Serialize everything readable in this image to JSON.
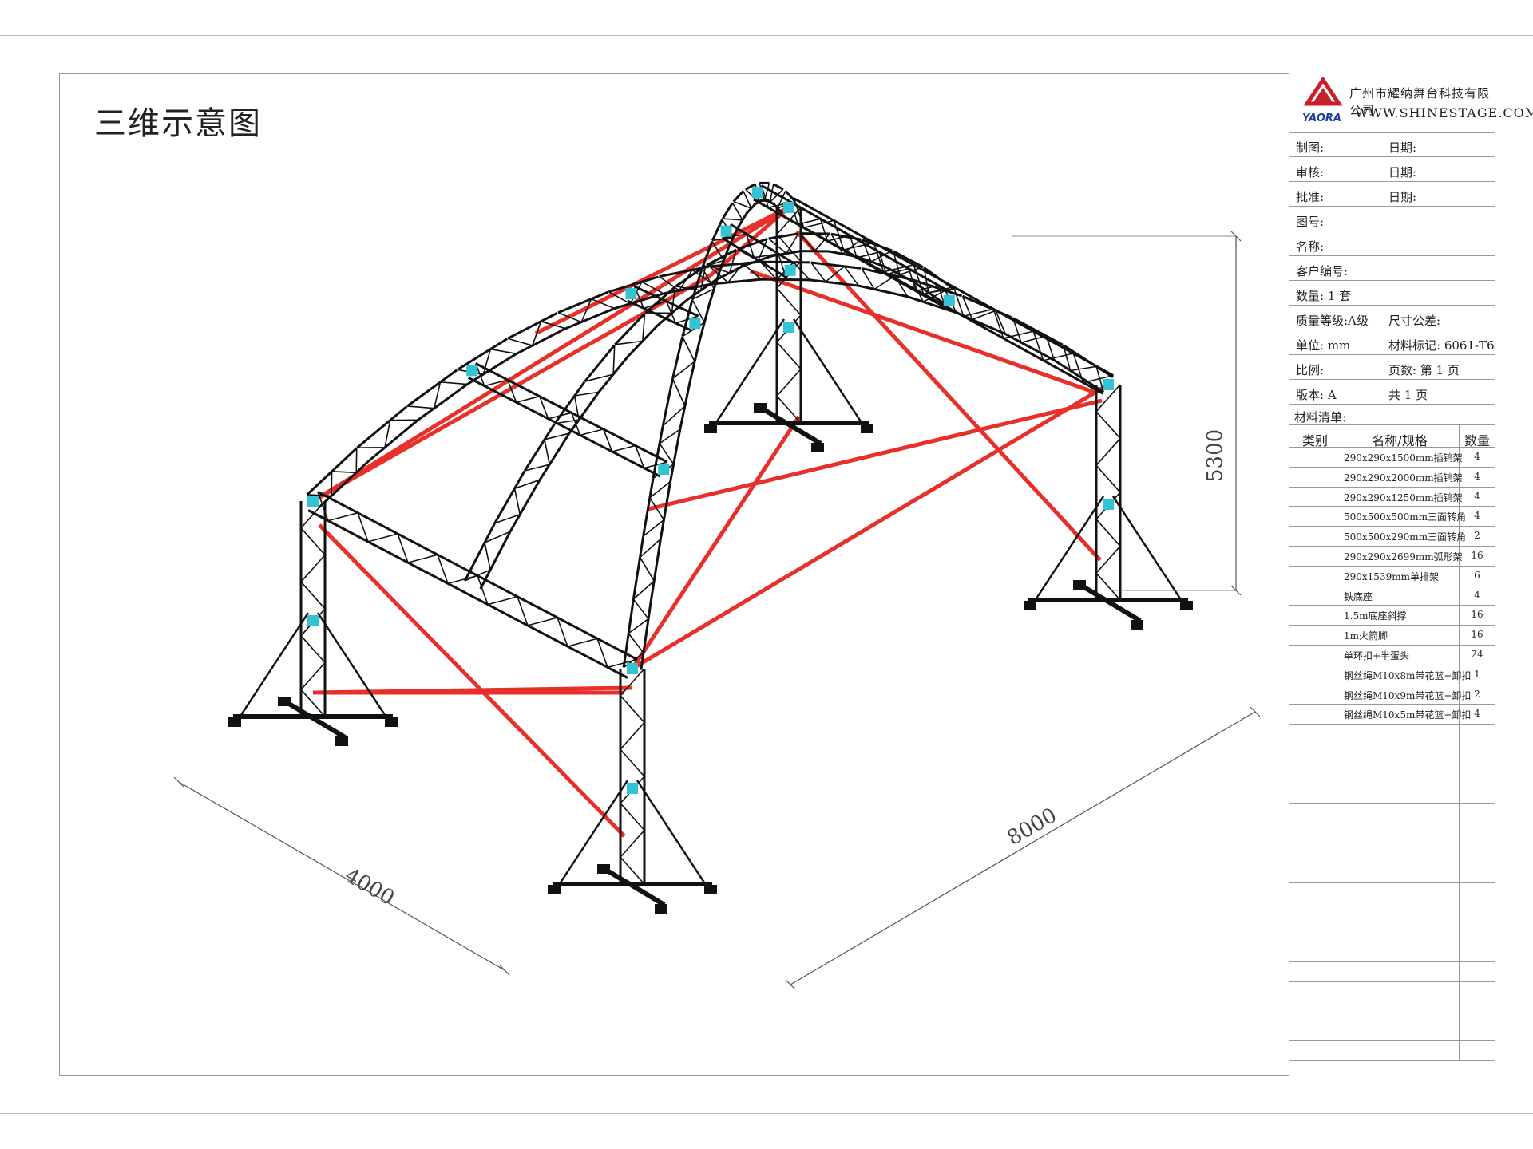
{
  "drawing_title": "三维示意图",
  "company": {
    "name_cn": "广州市耀纳舞台科技有限公司",
    "website": "WWW.SHINESTAGE.COM",
    "logo_text": "YAORA"
  },
  "title_block": {
    "rows": [
      {
        "label": "制图:",
        "right_label": "日期:"
      },
      {
        "label": "审核:",
        "right_label": "日期:"
      },
      {
        "label": "批准:",
        "right_label": "日期:"
      },
      {
        "label": "图号:",
        "right_label": ""
      },
      {
        "label": "名称:",
        "right_label": ""
      },
      {
        "label": "客户编号:",
        "right_label": ""
      },
      {
        "label": "数量:  1  套",
        "right_label": ""
      },
      {
        "label": "质量等级:A级",
        "right_label": "尺寸公差:"
      },
      {
        "label": "单位:    mm",
        "right_label": "材料标记: 6061-T6"
      },
      {
        "label": "比例:",
        "right_label": "页数: 第     1 页"
      },
      {
        "label": "版本:   A",
        "right_label": "共     1 页"
      }
    ],
    "bom_title": "材料清单:"
  },
  "bom": {
    "headers": [
      "类别",
      "名称/规格",
      "数量"
    ],
    "rows": [
      {
        "name": "290x290x1500mm插销架",
        "qty": "4"
      },
      {
        "name": "290x290x2000mm插销架",
        "qty": "4"
      },
      {
        "name": "290x290x1250mm插销架",
        "qty": "4"
      },
      {
        "name": "500x500x500mm三面转角",
        "qty": "4"
      },
      {
        "name": "500x500x290mm三面转角",
        "qty": "2"
      },
      {
        "name": "290x290x2699mm弧形架",
        "qty": "16"
      },
      {
        "name": "290x1539mm单排架",
        "qty": "6"
      },
      {
        "name": "铁底座",
        "qty": "4"
      },
      {
        "name": "1.5m底座斜撑",
        "qty": "16"
      },
      {
        "name": "1m火箭脚",
        "qty": "16"
      },
      {
        "name": "单环扣+半蛋头",
        "qty": "24"
      },
      {
        "name": "钢丝绳M10x8m带花篮+卸扣",
        "qty": "1"
      },
      {
        "name": "钢丝绳M10x9m带花篮+卸扣",
        "qty": "2"
      },
      {
        "name": "钢丝绳M10x5m带花篮+卸扣",
        "qty": "4"
      }
    ],
    "empty_rows": 17
  },
  "dimensions": {
    "width": "4000",
    "length": "8000",
    "height": "5300"
  },
  "colors": {
    "truss": "#111111",
    "cable": "#e8302a",
    "clamp": "#33c4d4",
    "frame": "#999999"
  }
}
